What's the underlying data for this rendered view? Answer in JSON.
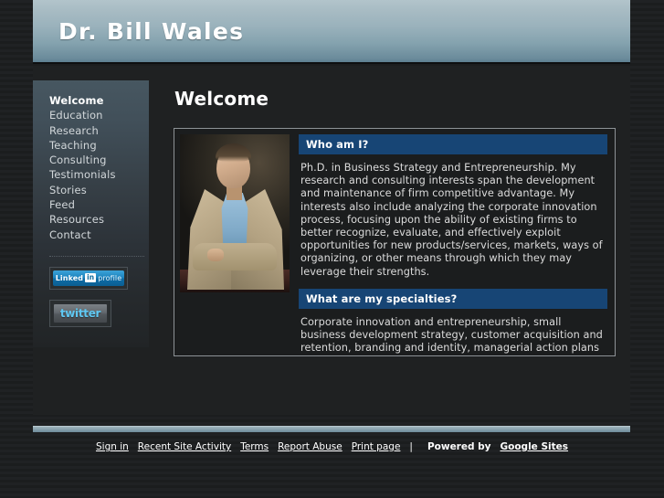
{
  "header": {
    "site_title": "Dr. Bill Wales"
  },
  "sidebar": {
    "items": [
      {
        "label": "Welcome",
        "active": true
      },
      {
        "label": "Education",
        "active": false
      },
      {
        "label": "Research",
        "active": false
      },
      {
        "label": "Teaching",
        "active": false
      },
      {
        "label": "Consulting",
        "active": false
      },
      {
        "label": "Testimonials",
        "active": false
      },
      {
        "label": "Stories",
        "active": false
      },
      {
        "label": "Feed",
        "active": false
      },
      {
        "label": "Resources",
        "active": false
      },
      {
        "label": "Contact",
        "active": false
      }
    ],
    "linkedin_badge": {
      "word_linked": "Linked",
      "word_in": "in",
      "word_profile": "profile"
    },
    "twitter_badge": {
      "label": "twitter"
    }
  },
  "main": {
    "page_title": "Welcome",
    "portrait_alt": "Portrait of Dr. Bill Wales",
    "sections": [
      {
        "heading": "Who am I?",
        "body": "Ph.D. in Business Strategy and Entrepreneurship. My research and consulting interests span the development and maintenance of firm competitive advantage. My interests also include analyzing the corporate innovation process, focusing upon the ability of existing firms to better recognize, evaluate, and effectively exploit opportunities for new products/services, markets, ways of organizing, or other means through which they may leverage their strengths."
      },
      {
        "heading": "What are my specialties?",
        "body": "Corporate innovation and entrepreneurship, small business development strategy, customer acquisition and retention, branding and identity, managerial action plans"
      }
    ]
  },
  "footer": {
    "links": [
      "Sign in",
      "Recent Site Activity",
      "Terms",
      "Report Abuse",
      "Print page"
    ],
    "separator": "|",
    "powered_by": "Powered by",
    "platform": "Google Sites"
  },
  "colors": {
    "header_top": "#b2c4cb",
    "header_bottom": "#5d7f90",
    "section_heading_bg": "#174575",
    "page_background": "#1d1f1f",
    "sidebar_top": "#475761",
    "linkedin_blue": "#0d6ca6",
    "twitter_text": "#5fc8f2",
    "footer_rule": "#87a0ac"
  }
}
